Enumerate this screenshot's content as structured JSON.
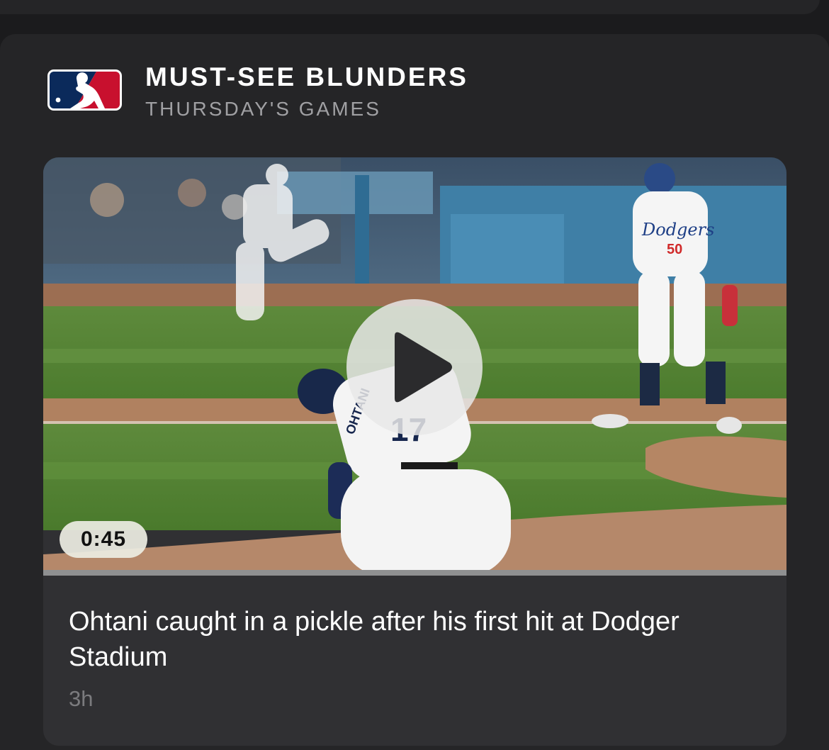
{
  "header": {
    "logo_icon": "mlb-logo-icon",
    "title": "MUST-SEE BLUNDERS",
    "subtitle": "THURSDAY'S GAMES"
  },
  "video": {
    "duration": "0:45",
    "progress": 0,
    "play_icon": "play-icon",
    "thumbnail_text": {
      "jersey_name": "OHTANI",
      "jersey_number": "17",
      "team_script": "Dodgers",
      "player_number": "50"
    }
  },
  "story": {
    "headline": "Ohtani caught in a pickle after his first hit at Dodger Stadium",
    "age": "3h"
  },
  "colors": {
    "background": "#1b1b1d",
    "card": "#252527",
    "story_card": "#303033",
    "mlb_blue": "#0b2a5b",
    "mlb_red": "#c8102e",
    "subtitle_gray": "#a0a0a3"
  }
}
